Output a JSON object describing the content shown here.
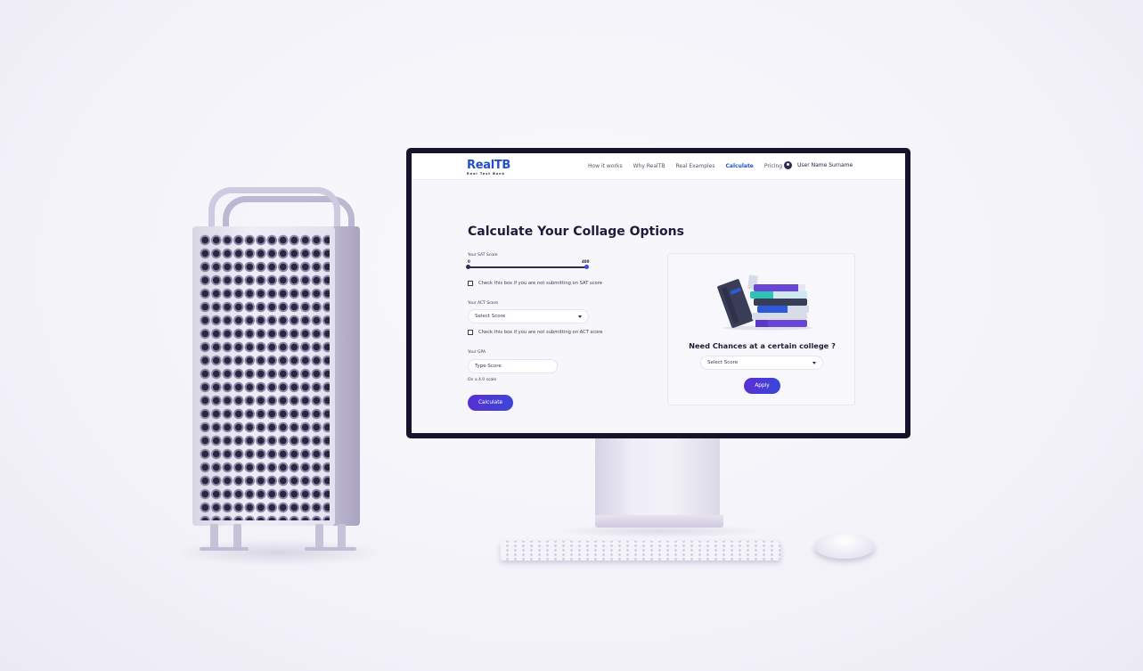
{
  "app": {
    "logo_text": "RealTB",
    "logo_tagline": "Real Test Bank"
  },
  "nav": {
    "links": [
      {
        "label": "How it works"
      },
      {
        "label": "Why RealTB"
      },
      {
        "label": "Real Examples"
      },
      {
        "label": "Calculate",
        "active": true
      },
      {
        "label": "Pricing"
      }
    ],
    "user_name": "User Name Surname"
  },
  "page": {
    "title": "Calculate Your Collage Options"
  },
  "form": {
    "sat_label": "Your SAT Score",
    "sat_min": "0",
    "sat_max": "400",
    "sat_slider_fraction": 1.0,
    "sat_checkbox_label": "Check this box if you are not submitting on SAT score",
    "act_label": "Your ACT Score",
    "act_select_value": "Select Score",
    "act_checkbox_label": "Check this box if you are not submitting on ACT score",
    "gpa_label": "Your GPA",
    "gpa_placeholder": "Type Score",
    "gpa_hint": "On a 4.0 scale",
    "calculate_label": "Calculate"
  },
  "card": {
    "title": "Need Chances at a certain college ?",
    "select_value": "Select Score",
    "apply_label": "Apply"
  },
  "colors": {
    "brand": "#2450c7",
    "button_start": "#5a2fd1",
    "button_end": "#3b46d9",
    "text_dark": "#1d1d3a"
  }
}
